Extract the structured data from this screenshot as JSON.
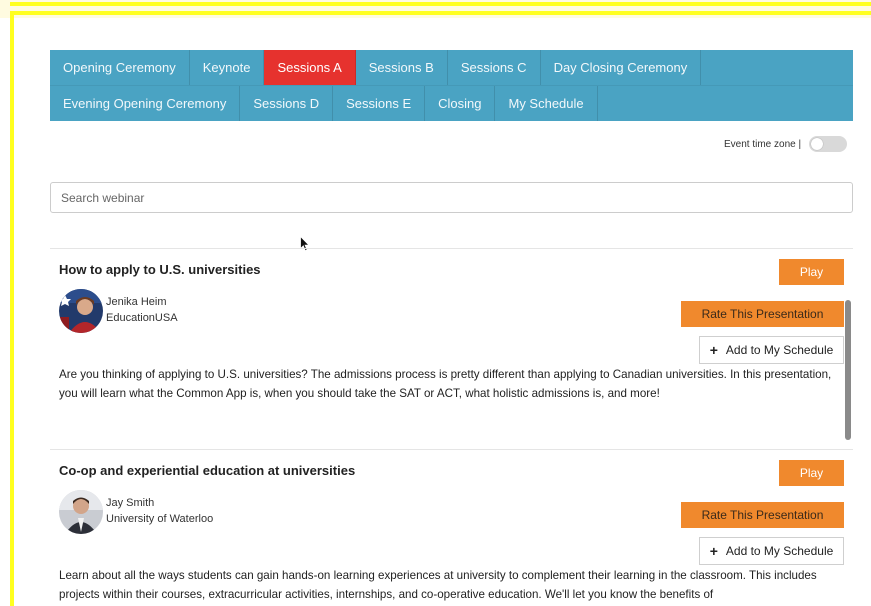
{
  "nav": {
    "row1": [
      {
        "label": "Opening Ceremony",
        "active": false
      },
      {
        "label": "Keynote",
        "active": false
      },
      {
        "label": "Sessions A",
        "active": true
      },
      {
        "label": "Sessions B",
        "active": false
      },
      {
        "label": "Sessions C",
        "active": false
      },
      {
        "label": "Day Closing Ceremony",
        "active": false
      }
    ],
    "row2": [
      {
        "label": "Evening Opening Ceremony",
        "active": false
      },
      {
        "label": "Sessions D",
        "active": false
      },
      {
        "label": "Sessions E",
        "active": false
      },
      {
        "label": "Closing",
        "active": false
      },
      {
        "label": "My Schedule",
        "active": false
      }
    ]
  },
  "timezone": {
    "label": "Event time zone |",
    "enabled": false
  },
  "search": {
    "placeholder": "Search webinar"
  },
  "sessions": [
    {
      "title": "How to apply to U.S. universities",
      "speaker_name": "Jenika Heim",
      "speaker_org": "EducationUSA",
      "play_label": "Play",
      "rate_label": "Rate This Presentation",
      "add_label": "Add to My Schedule",
      "description": "Are you thinking of applying to U.S. universities? The admissions process is pretty different than applying to Canadian universities. In this presentation, you will learn what the Common App is, when you should take the SAT or ACT, what holistic admissions is, and more!"
    },
    {
      "title": "Co-op and experiential education at universities",
      "speaker_name": "Jay Smith",
      "speaker_org": "University of Waterloo",
      "play_label": "Play",
      "rate_label": "Rate This Presentation",
      "add_label": "Add to My Schedule",
      "description": "Learn about all the ways students can gain hands-on learning experiences at university to complement their learning in the classroom. This includes projects within their courses, extracurricular activities, internships, and co-operative education. We'll let you know the benefits of"
    }
  ],
  "colors": {
    "nav_bg": "#4aa3c3",
    "active_tab": "#e6322e",
    "button_orange": "#f0892d",
    "frame_yellow": "#ffff1f"
  }
}
